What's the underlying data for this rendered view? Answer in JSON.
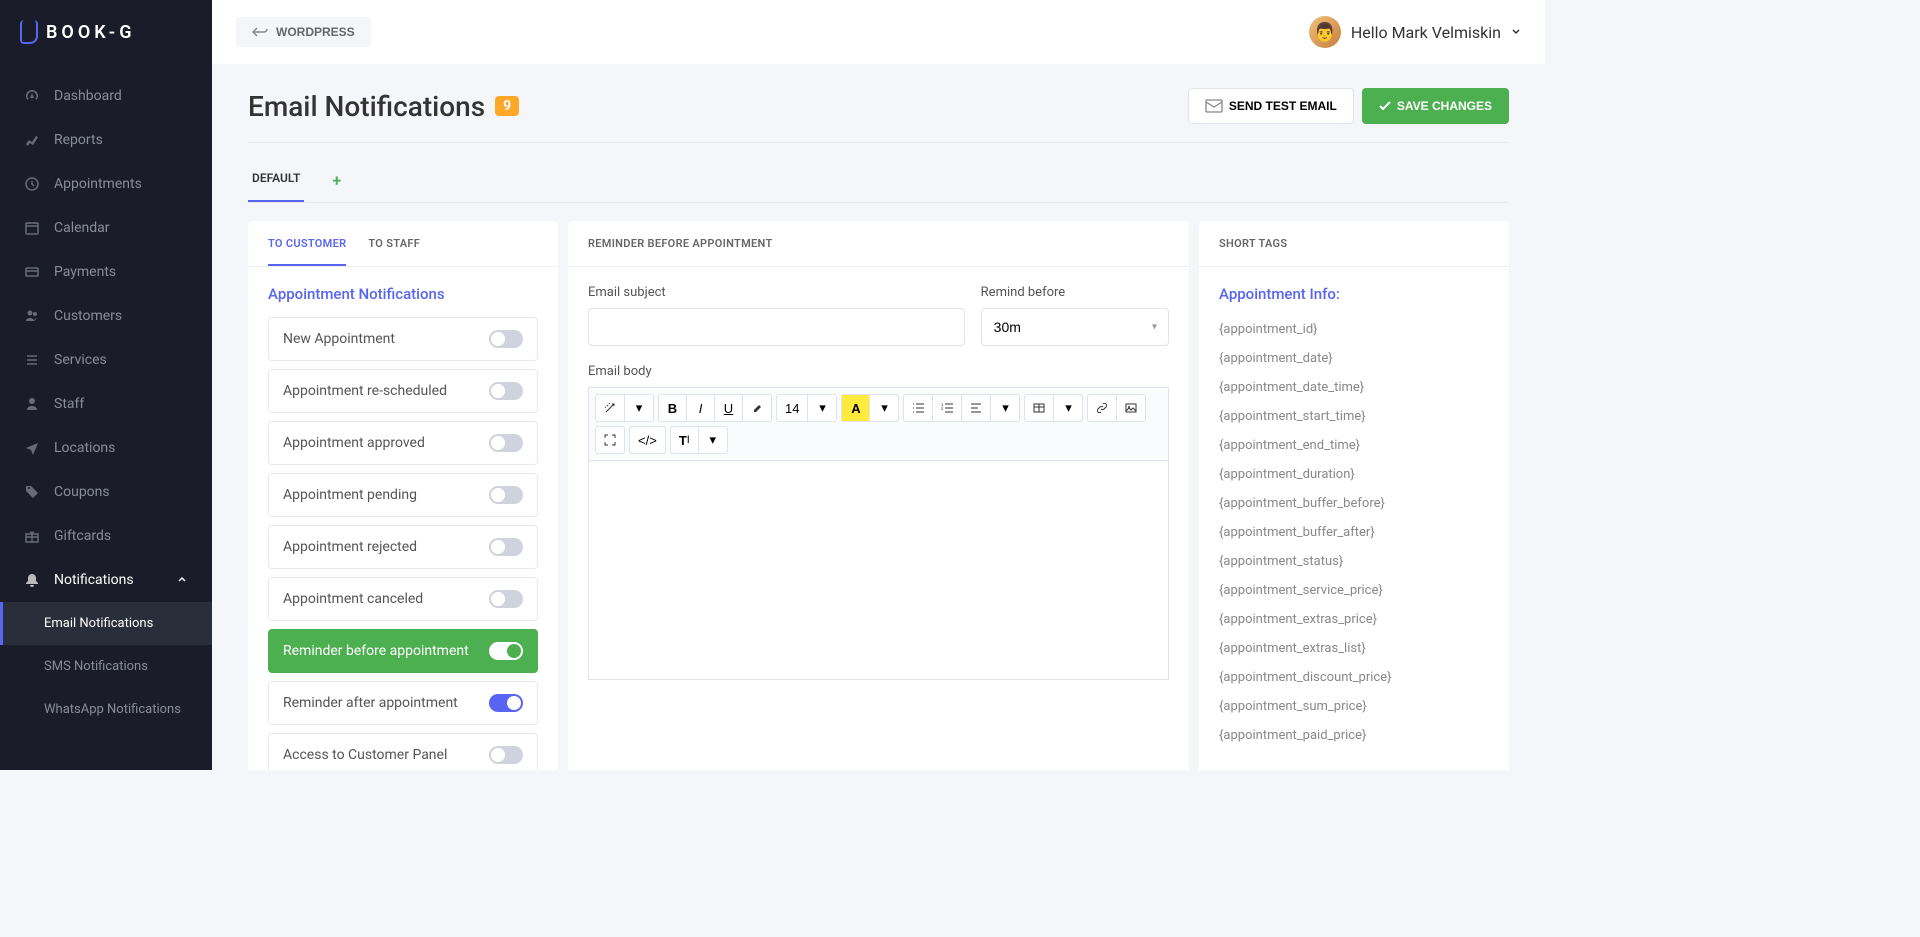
{
  "logo": "BOOK-G",
  "topbar": {
    "wordpress": "WORDPRESS",
    "greeting": "Hello Mark Velmiskin"
  },
  "sidebar": {
    "items": [
      {
        "icon": "dashboard",
        "label": "Dashboard"
      },
      {
        "icon": "reports",
        "label": "Reports"
      },
      {
        "icon": "appointments",
        "label": "Appointments"
      },
      {
        "icon": "calendar",
        "label": "Calendar"
      },
      {
        "icon": "payments",
        "label": "Payments"
      },
      {
        "icon": "customers",
        "label": "Customers"
      },
      {
        "icon": "services",
        "label": "Services"
      },
      {
        "icon": "staff",
        "label": "Staff"
      },
      {
        "icon": "locations",
        "label": "Locations"
      },
      {
        "icon": "coupons",
        "label": "Coupons"
      },
      {
        "icon": "giftcards",
        "label": "Giftcards"
      },
      {
        "icon": "notifications",
        "label": "Notifications",
        "expanded": true
      }
    ],
    "sub": [
      {
        "label": "Email Notifications",
        "active": true
      },
      {
        "label": "SMS Notifications"
      },
      {
        "label": "WhatsApp Notifications"
      }
    ]
  },
  "page": {
    "title": "Email Notifications",
    "badge": "9",
    "send_test": "SEND TEST EMAIL",
    "save": "SAVE CHANGES",
    "tab_default": "DEFAULT"
  },
  "left": {
    "tab_customer": "TO CUSTOMER",
    "tab_staff": "TO STAFF",
    "section": "Appointment Notifications",
    "items": [
      {
        "label": "New Appointment",
        "on": false
      },
      {
        "label": "Appointment re-scheduled",
        "on": false
      },
      {
        "label": "Appointment approved",
        "on": false
      },
      {
        "label": "Appointment pending",
        "on": false
      },
      {
        "label": "Appointment rejected",
        "on": false
      },
      {
        "label": "Appointment canceled",
        "on": false
      },
      {
        "label": "Reminder before appointment",
        "on": true,
        "active": true
      },
      {
        "label": "Reminder after appointment",
        "on": true
      },
      {
        "label": "Access to Customer Panel",
        "on": false
      }
    ]
  },
  "mid": {
    "header": "REMINDER BEFORE APPOINTMENT",
    "subject_label": "Email subject",
    "remind_label": "Remind before",
    "remind_value": "30m",
    "body_label": "Email body",
    "font_size": "14"
  },
  "right": {
    "header": "SHORT TAGS",
    "section": "Appointment Info:",
    "tags": [
      "{appointment_id}",
      "{appointment_date}",
      "{appointment_date_time}",
      "{appointment_start_time}",
      "{appointment_end_time}",
      "{appointment_duration}",
      "{appointment_buffer_before}",
      "{appointment_buffer_after}",
      "{appointment_status}",
      "{appointment_service_price}",
      "{appointment_extras_price}",
      "{appointment_extras_list}",
      "{appointment_discount_price}",
      "{appointment_sum_price}",
      "{appointment_paid_price}"
    ]
  }
}
